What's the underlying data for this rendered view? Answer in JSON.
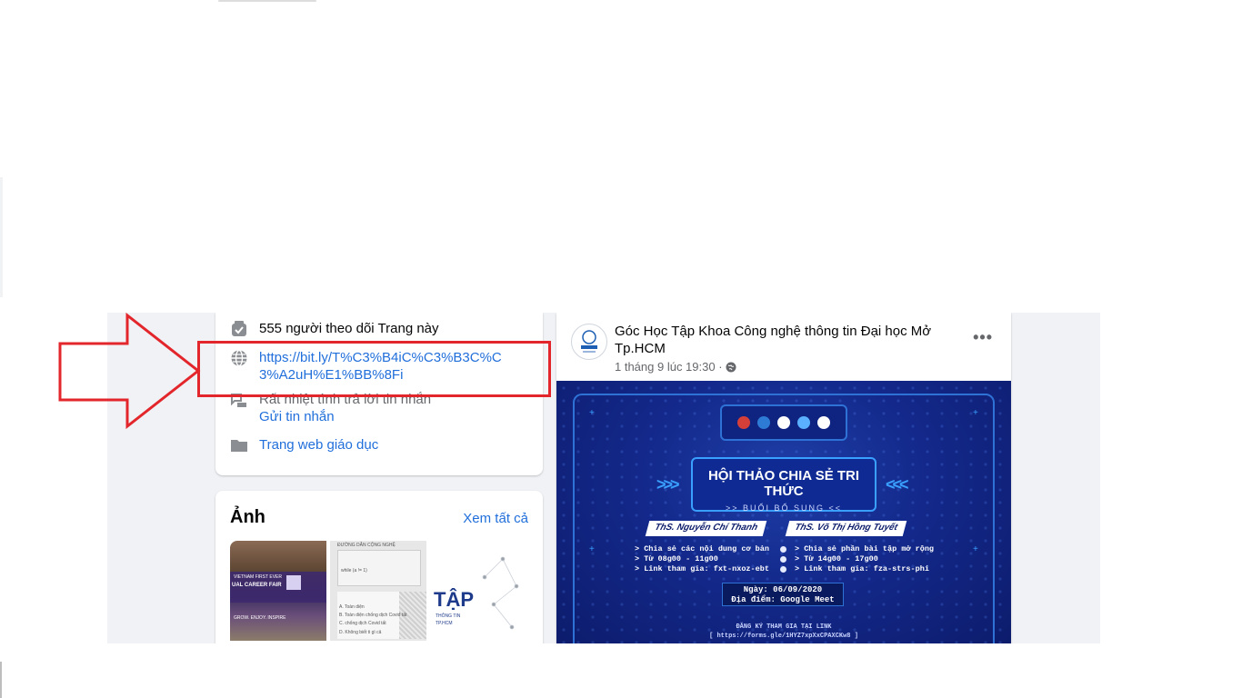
{
  "about": {
    "followers_text": "555 người theo dõi Trang này",
    "website_url": "https://bit.ly/T%C3%B4iC%C3%B3C%C3%A2uH%E1%BB%8Fi",
    "response_text": "Rất nhiệt tình trả lời tin nhắn",
    "send_message_label": "Gửi tin nhắn",
    "category_label": "Trang web giáo dục"
  },
  "photos": {
    "title": "Ảnh",
    "see_all_label": "Xem tất cả",
    "thumbs": [
      {
        "line1": "VIETNAM FIRST EVER",
        "line2": "UAL CAREER FAIR",
        "line3": "GROW. ENJOY. INSPIRE"
      },
      {
        "line1": "ĐƯỜNG DẪN CỘNG NGHỆ",
        "line2": "while (a != 1)",
        "line3": "A. Toàn diện",
        "line4": "B. Toàn diện chống dịch Covid tất",
        "line5": "C. chống dịch Covid tất",
        "line6": "D. Không biết ti gì cả"
      },
      {
        "big": "TẬP",
        "small": "THÔNG TIN",
        "small2": "TP.HCM"
      }
    ]
  },
  "post": {
    "author": "Góc Học Tập Khoa Công nghệ thông tin Đại học Mở Tp.HCM",
    "time": "1 tháng 9 lúc 19:30 ·",
    "more_icon": "more-horizontal-icon",
    "banner": {
      "title": "HỘI THẢO CHIA SẺ TRI THỨC",
      "subtitle": ">> BUỔI BỔ SUNG <<",
      "speaker1": "ThS. Nguyễn Chí Thanh",
      "speaker2": "ThS. Võ Thị Hồng Tuyết",
      "col1": [
        "> Chia sẻ các nội dung cơ bản",
        "> Từ 08g00 - 11g00",
        "> Link tham gia: fxt-nxoz-ebt"
      ],
      "col2": [
        "> Chia sẻ phần bài tập mở rộng",
        "> Từ 14g00 - 17g00",
        "> Link tham gia: fza-strs-phi"
      ],
      "date_line": "Ngày: 06/09/2020",
      "location_line": "Địa điểm: Google Meet",
      "register_line": "ĐĂNG KÝ THAM GIA TẠI LINK",
      "register_link": "[ https://forms.gle/1HYZ7xpXxCPAXCKw8 ]"
    }
  },
  "colors": {
    "link": "#216fdb",
    "highlight": "#e3262b",
    "page_bg": "#f0f2f5"
  }
}
